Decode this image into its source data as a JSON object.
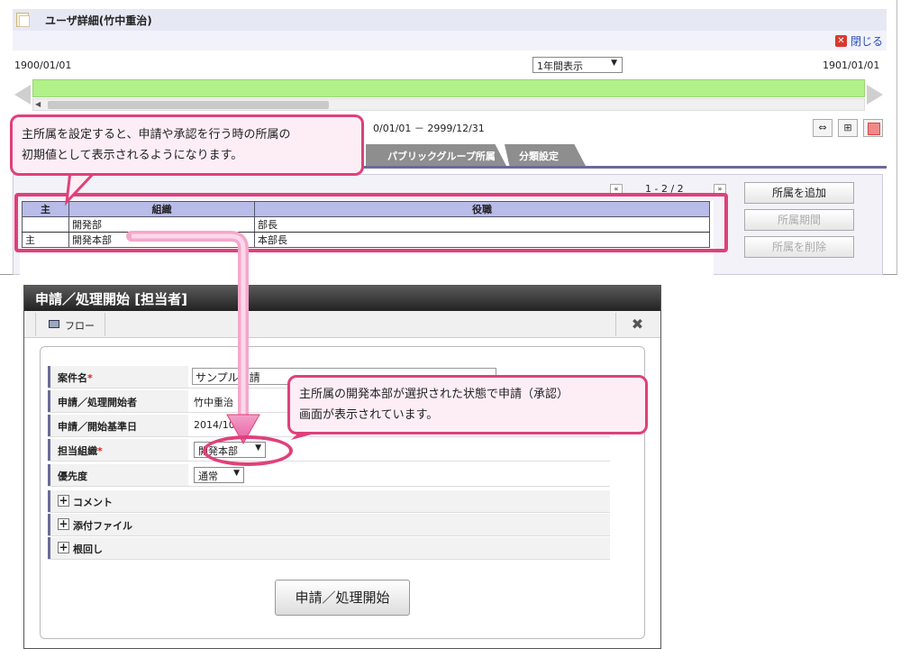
{
  "window": {
    "title": "ユーザ詳細(竹中重治)",
    "close_label": "閉じる",
    "close_icon": "close-icon"
  },
  "timeline": {
    "start_date": "1900/01/01",
    "end_date": "1901/01/01",
    "period_select": "1年間表示",
    "range_text": "0/01/01 － 2999/12/31"
  },
  "tabs": {
    "public_group": "パブリックグループ所属",
    "classification": "分類設定"
  },
  "pager": {
    "first": "«",
    "text": "1 - 2 / 2",
    "last": "»"
  },
  "org_table": {
    "headers": [
      "主",
      "組織",
      "役職"
    ],
    "rows": [
      {
        "main": "",
        "org": "開発部",
        "role": "部長"
      },
      {
        "main": "主",
        "org": "開発本部",
        "role": "本部長"
      }
    ]
  },
  "side_buttons": {
    "add": "所属を追加",
    "period": "所属期間",
    "delete": "所属を削除"
  },
  "callout1": {
    "line1": "主所属を設定すると、申請や承認を行う時の所属の",
    "line2": "初期値として表示されるようになります。"
  },
  "callout2": {
    "line1": "主所属の開発本部が選択された状態で申請（承認）",
    "line2": "画面が表示されています。"
  },
  "dialog": {
    "title": "申請／処理開始 [担当者]",
    "flow_tab": "フロー",
    "close_glyph": "✖",
    "fields": {
      "case_name_label": "案件名",
      "case_name_value": "サンプル申請",
      "applicant_label": "申請／処理開始者",
      "applicant_value": "竹中重治",
      "base_date_label": "申請／開始基準日",
      "base_date_value": "2014/10/30",
      "org_label": "担当組織",
      "org_value": "開発本部",
      "priority_label": "優先度",
      "priority_value": "通常",
      "required_mark": "*"
    },
    "sections": [
      "コメント",
      "添付ファイル",
      "根回し"
    ],
    "start_button": "申請／処理開始"
  }
}
